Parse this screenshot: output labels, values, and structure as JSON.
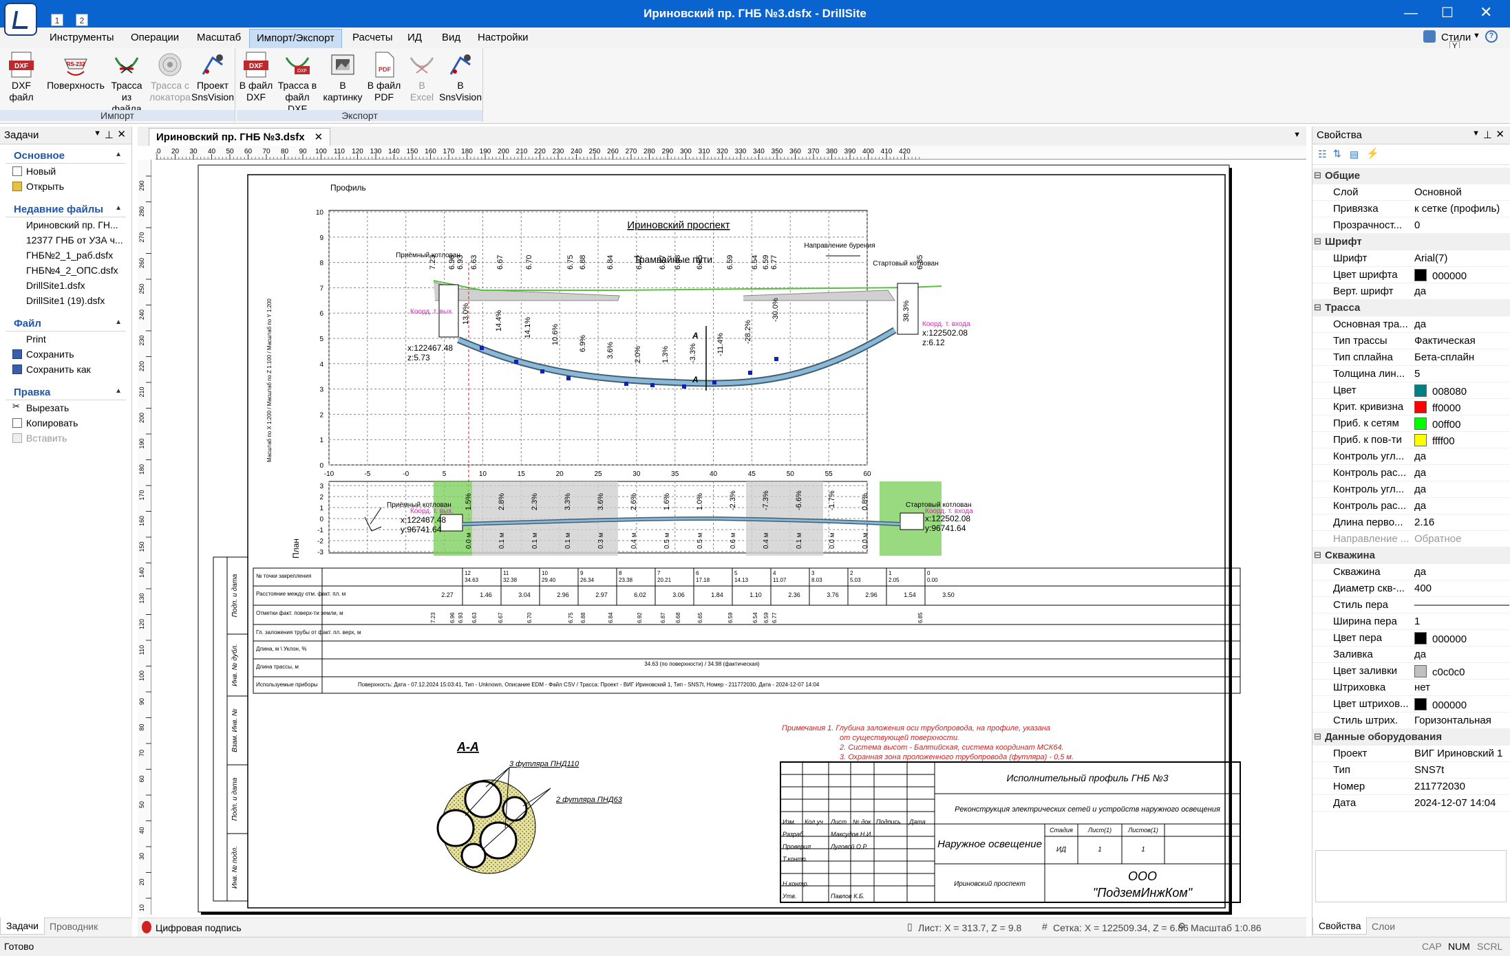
{
  "window": {
    "title": "Ириновский пр. ГНБ №3.dsfx - DrillSite",
    "qa_buttons": [
      "1",
      "2"
    ]
  },
  "menu": [
    "Инструменты",
    "Операции",
    "Масштаб",
    "Импорт/Экспорт",
    "Расчеты",
    "ИД",
    "Вид",
    "Настройки"
  ],
  "menu_right": {
    "styles": "Стили",
    "styles_key": "Y"
  },
  "ribbon": {
    "import_label": "Импорт",
    "export_label": "Экспорт",
    "import": [
      {
        "l1": "DXF",
        "l2": "файл",
        "icon": "dxf-file-icon"
      },
      {
        "l1": "Поверхность",
        "l2": "",
        "icon": "rs232-icon"
      },
      {
        "l1": "Трасса",
        "l2": "из файла",
        "icon": "route-file-icon"
      },
      {
        "l1": "Трасса с",
        "l2": "локатора",
        "icon": "locator-icon",
        "disabled": true
      },
      {
        "l1": "Проект",
        "l2": "SnsVision",
        "icon": "snsvision-icon"
      }
    ],
    "export": [
      {
        "l1": "В файл",
        "l2": "DXF",
        "icon": "dxf-export-icon"
      },
      {
        "l1": "Трасса в",
        "l2": "файл DXF",
        "icon": "route-dxf-icon"
      },
      {
        "l1": "В",
        "l2": "картинку",
        "icon": "image-export-icon"
      },
      {
        "l1": "В файл",
        "l2": "PDF",
        "icon": "pdf-icon"
      },
      {
        "l1": "В",
        "l2": "Excel",
        "icon": "excel-icon",
        "disabled": true
      },
      {
        "l1": "В",
        "l2": "SnsVision",
        "icon": "snsvision-export-icon"
      }
    ]
  },
  "left": {
    "title": "Задачи",
    "sections": {
      "main": {
        "title": "Основное",
        "items": [
          "Новый",
          "Открыть"
        ]
      },
      "recent": {
        "title": "Недавние файлы",
        "items": [
          "Ириновский пр. ГН...",
          "12377 ГНБ от УЗА ч...",
          "ГНБ№2_1_раб.dsfx",
          "ГНБ№4_2_ОПС.dsfx",
          "DrillSite1.dsfx",
          "DrillSite1 (19).dsfx"
        ]
      },
      "file": {
        "title": "Файл",
        "items": [
          "Print",
          "Сохранить",
          "Сохранить как"
        ]
      },
      "edit": {
        "title": "Правка",
        "items": [
          "Вырезать",
          "Копировать",
          "Вставить"
        ]
      }
    },
    "tabs": [
      "Задачи",
      "Проводник"
    ]
  },
  "doc": {
    "tab": "Ириновский пр. ГНБ №3.dsfx",
    "sign": "Цифровая подпись",
    "sheet_coord": "Лист: X = 313.7, Z = 9.8",
    "grid_coord": "Сетка: X = 122509.34, Z = 6.86",
    "zoom": "Масштаб 1:0.86"
  },
  "ruler": {
    "h": [
      "10",
      "20",
      "30",
      "40",
      "50",
      "60",
      "70",
      "80",
      "90",
      "100",
      "110",
      "120",
      "130",
      "140",
      "150",
      "160",
      "170",
      "180",
      "190",
      "200",
      "210",
      "220",
      "230",
      "240",
      "250",
      "260",
      "270",
      "280",
      "290",
      "300",
      "310",
      "320",
      "330",
      "340",
      "350",
      "360",
      "370",
      "380",
      "390",
      "400",
      "410",
      "420"
    ],
    "v": [
      "290",
      "280",
      "270",
      "260",
      "250",
      "240",
      "230",
      "220",
      "210",
      "200",
      "190",
      "180",
      "170",
      "160",
      "150",
      "140",
      "130",
      "120",
      "110",
      "100",
      "90",
      "80",
      "70",
      "60",
      "50",
      "40",
      "30",
      "20",
      "10"
    ]
  },
  "drawing": {
    "profile_title": "Профиль",
    "street": "Ириновский проспект",
    "tram": "Трамвайные пути",
    "direction": "Направление бурения",
    "exit_pit": "Приёмный котлован",
    "entry_pit": "Стартовый котлован",
    "coord_exit": "Коорд. т. вых.",
    "coord_entry": "Коорд. т. входа",
    "exit_x": "x:122467.48",
    "exit_z": "z:5.73",
    "entry_x": "x:122502.08",
    "entry_z": "z:6.12",
    "exit_y": "y:96741.64",
    "entry_y": "y:96741.64",
    "plan_label": "План",
    "scale_note": "Масштаб по X 1:200 / Масштаб по Z 1:100 / Масштаб по Y 1:200",
    "section_mark": "A",
    "section_title": "А-А",
    "pipe110": "3 футляра ПНД110",
    "pipe63": "2 футляра ПНД63",
    "yticks": [
      "10",
      "9",
      "8",
      "7",
      "6",
      "5",
      "4",
      "3",
      "2",
      "1",
      "0"
    ],
    "xticks": [
      "-10",
      "-5",
      "-0",
      "5",
      "10",
      "15",
      "20",
      "25",
      "30",
      "35",
      "40",
      "45",
      "50",
      "55",
      "60"
    ],
    "plan_yticks": [
      "3",
      "2",
      "1",
      "0",
      "-1",
      "-2",
      "-3"
    ],
    "surface_labels": [
      "7.23",
      "6.96",
      "6.93",
      "6.63",
      "6.67",
      "6.70",
      "6.75",
      "6.88",
      "6.84",
      "6.92",
      "6.87",
      "6.68",
      "6.65",
      "6.59",
      "6.54",
      "6.59",
      "6.77",
      "6.85"
    ],
    "slopes": [
      "13.0%",
      "14.4%",
      "14.1%",
      "10.6%",
      "6.9%",
      "3.6%",
      "2.0%",
      "1.3%",
      "-3.3%",
      "-11.4%",
      "-28.2%",
      "-30.0%",
      "38.3%"
    ],
    "plan_slopes": [
      "1.5%",
      "2.8%",
      "2.3%",
      "3.3%",
      "3.6%",
      "2.6%",
      "1.6%",
      "1.0%",
      "-2.3%",
      "-7.3%",
      "-6.6%",
      "-1.7%",
      "0.8%"
    ],
    "plan_offsets": [
      "0.0 м",
      "0.1 м",
      "0.1 м",
      "0.1 м",
      "0.3 м",
      "0.4 м",
      "0.5 м",
      "0.5 м",
      "0.6 м",
      "0.4 м",
      "0.1 м",
      "0.0 м",
      "0.0 м"
    ],
    "table": {
      "row_titles": [
        "№ точки закрепления",
        "Расстояние между отм. факт. пл. м",
        "Отметки факт. поверх-ти земли, м",
        "Гл. заложения трубы от факт. пл. верх, м",
        "Длина, м \\ Уклон, %",
        "Длина трассы, м",
        "Используемые приборы"
      ],
      "points": [
        "12",
        "11",
        "10",
        "9",
        "8",
        "7",
        "6",
        "5",
        "4",
        "3",
        "2",
        "1",
        "0"
      ],
      "point_dist": [
        "34.63",
        "32.38",
        "29.40",
        "26.34",
        "23.38",
        "20.21",
        "17.18",
        "14.13",
        "11.07",
        "8.03",
        "5.03",
        "2.05",
        "0.00"
      ],
      "spacing": [
        "2.27",
        "1.46",
        "3.04",
        "2.96",
        "2.97",
        "6.02",
        "3.06",
        "1.84",
        "1.10",
        "2.36",
        "3.76",
        "2.96",
        "1.54",
        "3.50"
      ],
      "route_length": "34.63 (по поверхности) / 34.98 (фактическая)",
      "instruments": "Поверхность: Дата - 07.12.2024 15:03:41, Тип - Unknown, Описание EDM - Файл CSV / Трасса: Проект - ВИГ Ириновский 1, Тип - SNS7t, Номер - 211772030, Дата - 2024-12-07 14:04"
    },
    "notes": [
      "Примечания  1. Глубина заложения оси трубопровода, на профиле, указана",
      "от существующей поверхности.",
      "2. Система высот - Балтийская, система координат МСК64.",
      "3. Охранная зона проложенного трубопровода (футляра) - 0,5 м."
    ],
    "stamp": {
      "title": "Исполнительный профиль ГНБ №3",
      "subtitle": "Реконструкция электрических сетей  и устройств наружного освещения",
      "object": "Наружное освещение",
      "place": "Ириновский проспект",
      "company1": "ООО",
      "company2": "\"ПодземИнжКом\"",
      "heads": [
        "Изм.",
        "Кол.уч",
        "Лист",
        "№ док",
        "Подпись",
        "Дата"
      ],
      "roles": [
        "Разраб.",
        "Проверил",
        "Т.контр.",
        "",
        "Н.контр.",
        "Утв."
      ],
      "names": [
        "Максудов Н.И.",
        "Луговой О.Р.",
        "",
        "",
        "",
        "Павлов К.Б."
      ],
      "stage_heads": [
        "Стадия",
        "Лист(1)",
        "Листов(1)"
      ],
      "stage_vals": [
        "ИД",
        "1",
        "1"
      ]
    },
    "side_labels": [
      "Подп. и дата",
      "Инв. № дубл.",
      "Взам. Инв. №",
      "Подп. и дата",
      "Инв. № подл."
    ]
  },
  "right": {
    "title": "Свойства",
    "categories": [
      {
        "name": "Общие",
        "rows": [
          [
            "Слой",
            "Основной"
          ],
          [
            "Привязка",
            "к сетке (профиль)"
          ],
          [
            "Прозрачност...",
            "0"
          ]
        ]
      },
      {
        "name": "Шрифт",
        "rows": [
          [
            "Шрифт",
            "Arial(7)"
          ],
          [
            "Цвет шрифта",
            "000000",
            "#000000"
          ],
          [
            "Верт. шрифт",
            "да"
          ]
        ]
      },
      {
        "name": "Трасса",
        "rows": [
          [
            "Основная тра...",
            "да"
          ],
          [
            "Тип трассы",
            "Фактическая"
          ],
          [
            "Тип сплайна",
            "Бета-сплайн"
          ],
          [
            "Толщина лин...",
            "5"
          ],
          [
            "Цвет",
            "008080",
            "#008080"
          ],
          [
            "Крит. кривизна",
            "ff0000",
            "#ff0000"
          ],
          [
            "Приб. к сетям",
            "00ff00",
            "#00ff00"
          ],
          [
            "Приб. к пов-ти",
            "ffff00",
            "#ffff00"
          ],
          [
            "Контроль угл...",
            "да"
          ],
          [
            "Контроль рас...",
            "да"
          ],
          [
            "Контроль угл...",
            "да"
          ],
          [
            "Контроль рас...",
            "да"
          ],
          [
            "Длина перво...",
            "2.16"
          ],
          [
            "Направление ...",
            "Обратное",
            "",
            "dis"
          ]
        ]
      },
      {
        "name": "Скважина",
        "rows": [
          [
            "Скважина",
            "да"
          ],
          [
            "Диаметр скв-...",
            "400"
          ],
          [
            "Стиль пера",
            "———————————"
          ],
          [
            "Ширина пера",
            "1"
          ],
          [
            "Цвет пера",
            "000000",
            "#000000"
          ],
          [
            "Заливка",
            "да"
          ],
          [
            "Цвет заливки",
            "c0c0c0",
            "#c0c0c0"
          ],
          [
            "Штриховка",
            "нет"
          ],
          [
            "Цвет штрихов...",
            "000000",
            "#000000"
          ],
          [
            "Стиль штрих.",
            "Горизонтальная"
          ]
        ]
      },
      {
        "name": "Данные оборудования",
        "rows": [
          [
            "Проект",
            "ВИГ Ириновский 1"
          ],
          [
            "Тип",
            "SNS7t"
          ],
          [
            "Номер",
            " 211772030"
          ],
          [
            "Дата",
            "2024-12-07 14:04"
          ]
        ]
      }
    ],
    "tabs": [
      "Свойства",
      "Слои"
    ]
  },
  "status": {
    "ready": "Готово",
    "cap": "CAP",
    "num": "NUM",
    "scrl": "SCRL"
  }
}
